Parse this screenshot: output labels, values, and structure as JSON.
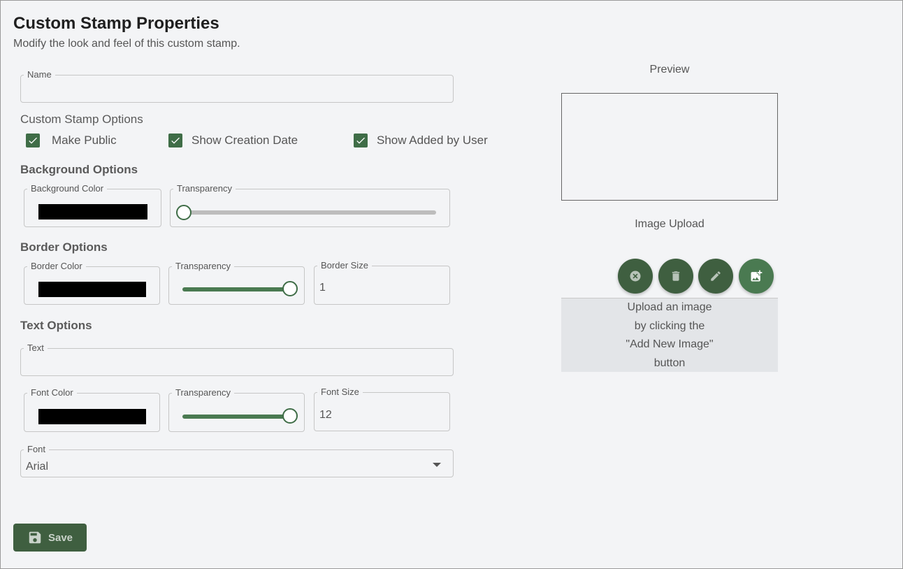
{
  "header": {
    "title": "Custom Stamp Properties",
    "subtitle": "Modify the look and feel of this custom stamp."
  },
  "name_field": {
    "label": "Name",
    "value": ""
  },
  "stamp_options": {
    "label": "Custom Stamp Options",
    "make_public": {
      "label": "Make Public",
      "checked": true
    },
    "show_creation_date": {
      "label": "Show Creation Date",
      "checked": true
    },
    "show_added_by_user": {
      "label": "Show Added by User",
      "checked": true
    }
  },
  "background": {
    "heading": "Background Options",
    "color_label": "Background Color",
    "color": "#000000",
    "transparency_label": "Transparency",
    "transparency_value": 0
  },
  "border": {
    "heading": "Border Options",
    "color_label": "Border Color",
    "color": "#000000",
    "transparency_label": "Transparency",
    "transparency_value": 1,
    "size_label": "Border Size",
    "size_value": "1"
  },
  "text": {
    "heading": "Text Options",
    "text_label": "Text",
    "text_value": "",
    "font_color_label": "Font Color",
    "font_color": "#000000",
    "transparency_label": "Transparency",
    "transparency_value": 1,
    "font_size_label": "Font Size",
    "font_size_value": "12",
    "font_label": "Font",
    "font_value": "Arial"
  },
  "preview": {
    "label": "Preview"
  },
  "image_upload": {
    "label": "Image Upload",
    "message_lines": [
      "Upload an image",
      "by clicking the",
      "\"Add New Image\"",
      "button"
    ],
    "buttons": [
      "cancel-icon",
      "trash-icon",
      "pencil-icon",
      "add-image-icon"
    ]
  },
  "actions": {
    "save_label": "Save"
  },
  "colors": {
    "accent": "#3f6d47",
    "button_dark": "#3f5f40",
    "slider_inactive": "#bdbdbd"
  }
}
